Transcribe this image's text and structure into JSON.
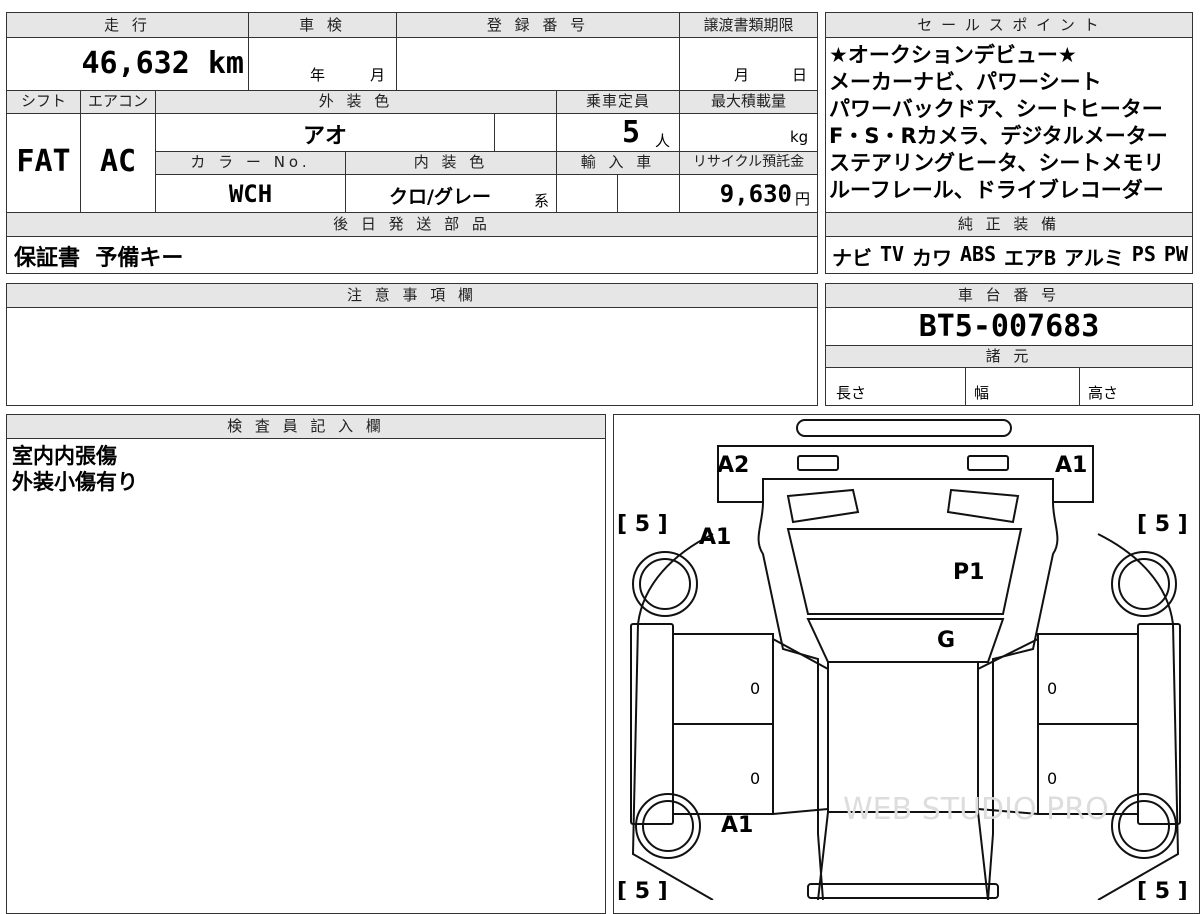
{
  "top_table": {
    "mileage_label": "走 行",
    "mileage_value": "46,632 km",
    "inspection_label": "車 検",
    "inspection_year_label": "年",
    "inspection_month_label": "月",
    "registration_label": "登 録 番 号",
    "transfer_deadline_label": "譲渡書類期限",
    "transfer_month_label": "月",
    "transfer_day_label": "日",
    "shift_label": "シフト",
    "shift_value": "FAT",
    "ac_label": "エアコン",
    "ac_value": "AC",
    "exterior_color_label": "外 装 色",
    "exterior_color_value": "アオ",
    "capacity_label": "乗車定員",
    "capacity_value": "5",
    "capacity_unit": "人",
    "max_load_label": "最大積載量",
    "max_load_unit": "kg",
    "color_no_label": "カ ラ ー No.",
    "color_no_value": "WCH",
    "interior_color_label": "内 装 色",
    "interior_color_value": "クロ/グレー",
    "interior_suffix": "系",
    "import_label": "輸 入 車",
    "recycle_label": "リサイクル預託金",
    "recycle_value": "9,630",
    "recycle_unit": "円",
    "later_parts_label": "後 日 発 送 部 品",
    "later_parts_value": "保証書  予備キー"
  },
  "sales_points": {
    "title": "セ ー ル ス ポ イ ン ト",
    "lines": [
      "★オークションデビュー★",
      "メーカーナビ、パワーシート",
      "パワーバックドア、シートヒーター",
      "F・S・Rカメラ、デジタルメーター",
      "ステアリングヒータ、シートメモリ",
      "ルーフレール、ドライブレコーダー"
    ]
  },
  "equipment": {
    "title": "純 正 装 備",
    "items": [
      "ナビ",
      "TV",
      "カワ",
      "ABS",
      "エアB",
      "アルミ",
      "PS",
      "PW"
    ]
  },
  "notes": {
    "title": "注 意 事 項 欄",
    "text": ""
  },
  "chassis": {
    "title": "車 台 番 号",
    "value": "BT5-007683",
    "specs_title": "諸 元",
    "length_label": "長さ",
    "width_label": "幅",
    "height_label": "高さ"
  },
  "inspector": {
    "title": "検 査 員 記 入 欄",
    "lines": [
      "室内内張傷",
      "外装小傷有り"
    ]
  },
  "diagram": {
    "tire_marks": [
      "[ 5 ]",
      "[ 5 ]",
      "[ 5 ]",
      "[ 5 ]"
    ],
    "damage": {
      "rear_left": "A2",
      "rear_right": "A1",
      "left_rear_quarter": "A1",
      "roof": "P1",
      "windshield": "G",
      "left_front_fender": "A1"
    },
    "door_values": [
      "0",
      "0",
      "0",
      "0"
    ],
    "watermark": "WEB STUDIO PRO"
  }
}
